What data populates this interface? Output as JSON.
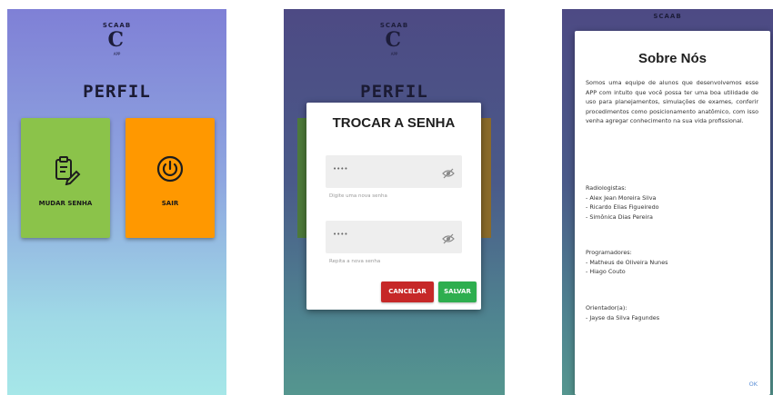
{
  "screen1": {
    "logo": {
      "arc_text": "SCAAB",
      "letter": "C",
      "sub_text": "APP"
    },
    "title": "PERFIL",
    "tiles": [
      {
        "label": "MUDAR SENHA",
        "icon": "clipboard-edit-icon",
        "color": "#8bc34a"
      },
      {
        "label": "SAIR",
        "icon": "power-icon",
        "color": "#ff9800"
      }
    ]
  },
  "screen2": {
    "logo": {
      "arc_text": "SCAAB",
      "letter": "C",
      "sub_text": "APP"
    },
    "title": "PERFIL",
    "dialog": {
      "title": "TROCAR A SENHA",
      "field1": {
        "value": "••••",
        "hint": "Digite uma nova senha"
      },
      "field2": {
        "value": "••••",
        "hint": "Repita a nova senha"
      },
      "cancel_label": "CANCELAR",
      "save_label": "SALVAR"
    }
  },
  "screen3": {
    "logo": {
      "arc_text": "SCAAB"
    },
    "about": {
      "title": "Sobre Nós",
      "paragraph": "Somos uma equipe de alunos que desenvolvemos esse APP com intuito que você possa ter uma boa utilidade de uso para planejamentos, simulações de exames, conferir procedimentos como posicionamento anatômico, com isso venha agregar conhecimento na sua vida profissional.",
      "sections": [
        {
          "heading": "Radiologistas:",
          "items": [
            "- Alex Jean Moreira Silva",
            "- Ricardo Elias Figueiredo",
            "- Simônica Dias Pereira"
          ]
        },
        {
          "heading": "Programadores:",
          "items": [
            "- Matheus de Oliveira Nunes",
            "- Hiago Couto"
          ]
        },
        {
          "heading": "Orientador(a):",
          "items": [
            "- Jayse da Silva Fagundes"
          ]
        }
      ],
      "ok_label": "OK"
    }
  }
}
